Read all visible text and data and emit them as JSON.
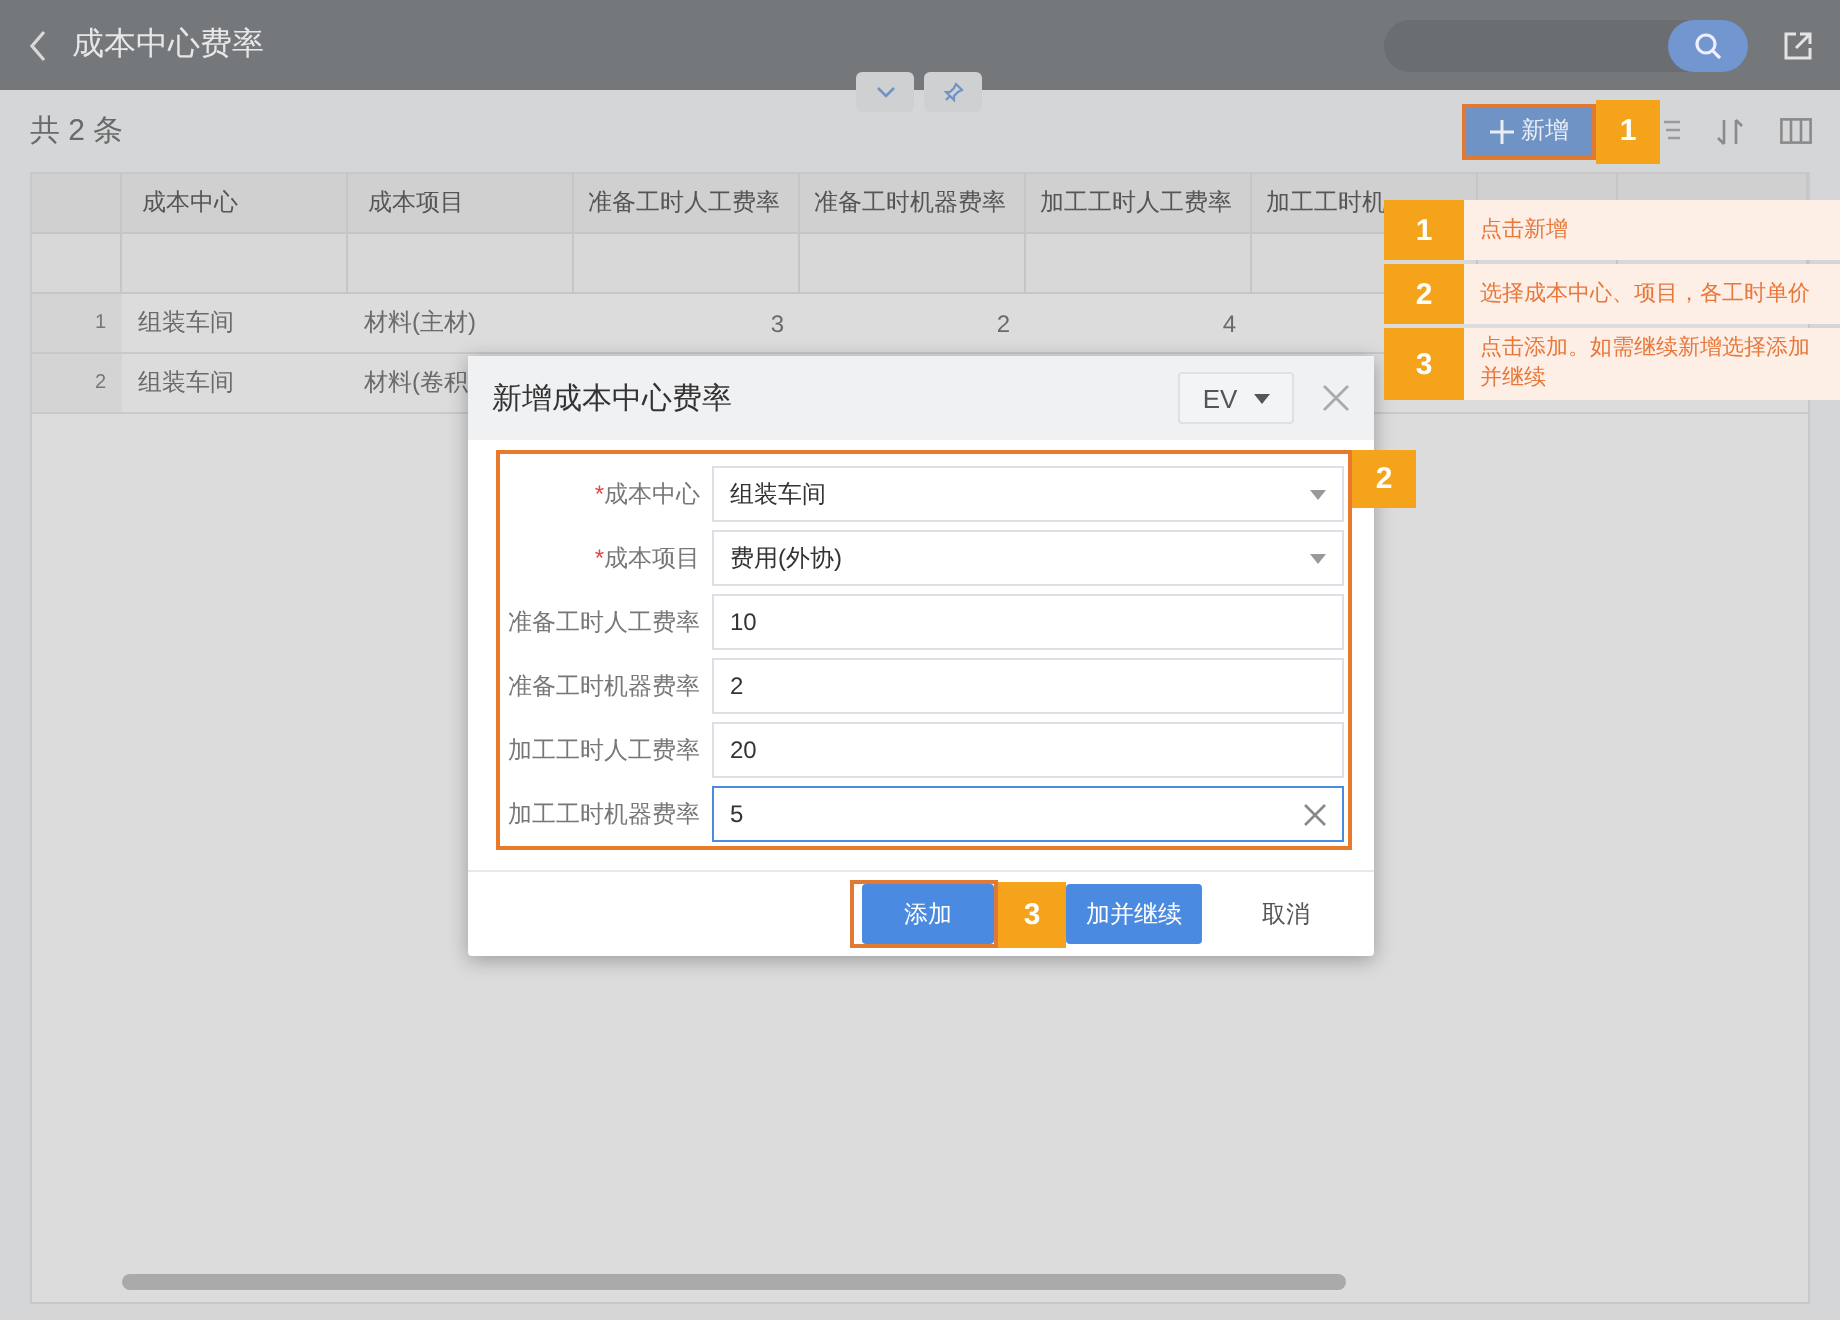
{
  "header": {
    "title": "成本中心费率"
  },
  "toolbar": {
    "count": "共 2 条",
    "add_button": "新增",
    "marker": "1"
  },
  "table": {
    "columns": [
      {
        "label": "成本中心",
        "kind": "text"
      },
      {
        "label": "成本项目",
        "kind": "text"
      },
      {
        "label": "准备工时人工费率",
        "kind": "number"
      },
      {
        "label": "准备工时机器费率",
        "kind": "number"
      },
      {
        "label": "加工工时人工费率",
        "kind": "number"
      },
      {
        "label": "加工工时机",
        "kind": "number"
      }
    ],
    "rows": [
      {
        "index": "1",
        "cells": [
          "组装车间",
          "材料(主材)",
          "3",
          "2",
          "4"
        ]
      },
      {
        "index": "2",
        "cells": [
          "组装车间",
          "材料(卷积"
        ]
      }
    ]
  },
  "dialog": {
    "title": "新增成本中心费率",
    "language": "EV",
    "marker": "2",
    "fields": [
      {
        "kind": "select",
        "required_mark": "*",
        "label": "成本中心",
        "value": "组装车间",
        "focused": false
      },
      {
        "kind": "select",
        "required_mark": "*",
        "label": "成本项目",
        "value": "费用(外协)",
        "focused": false
      },
      {
        "kind": "text",
        "label": "准备工时人工费率",
        "value": "10",
        "focused": false
      },
      {
        "kind": "text",
        "label": "准备工时机器费率",
        "value": "2",
        "focused": false
      },
      {
        "kind": "text",
        "label": "加工工时人工费率",
        "value": "20",
        "focused": false
      },
      {
        "kind": "text",
        "label": "加工工时机器费率",
        "value": "5",
        "focused": true
      }
    ],
    "footer": [
      {
        "kind": "primary",
        "label": "添加",
        "highlighted": true
      },
      {
        "kind": "marker",
        "label": "3"
      },
      {
        "kind": "primary",
        "label": "加并继续",
        "highlighted": false
      },
      {
        "kind": "plain",
        "label": "取消",
        "highlighted": false
      }
    ]
  },
  "guide": [
    {
      "number": "1",
      "text": "点击新增"
    },
    {
      "number": "2",
      "text": "选择成本中心、项目，各工时单价"
    },
    {
      "number": "3",
      "text": "点击添加。如需继续新增选择添加并继续"
    }
  ]
}
